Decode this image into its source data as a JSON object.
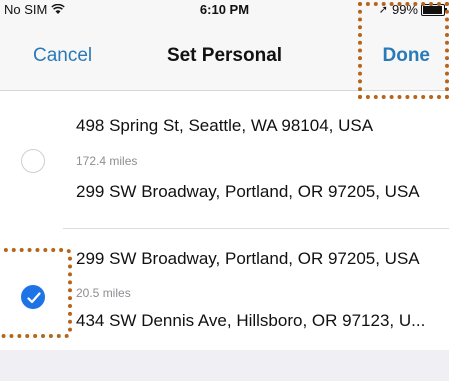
{
  "status_bar": {
    "carrier": "No SIM",
    "time": "6:10 PM",
    "battery": "99%"
  },
  "nav": {
    "cancel_label": "Cancel",
    "title": "Set Personal",
    "done_label": "Done"
  },
  "routes": [
    {
      "origin": "498 Spring St, Seattle, WA 98104, USA",
      "distance": "172.4 miles",
      "destination": "299 SW Broadway, Portland, OR 97205, USA",
      "selected": false
    },
    {
      "origin": "299 SW Broadway, Portland, OR 97205, USA",
      "distance": "20.5 miles",
      "destination": "434 SW Dennis Ave, Hillsboro, OR 97123, U...",
      "selected": true
    }
  ],
  "colors": {
    "accent": "#2a7ab8",
    "checked": "#1e74e6",
    "highlight": "#b5651d"
  }
}
